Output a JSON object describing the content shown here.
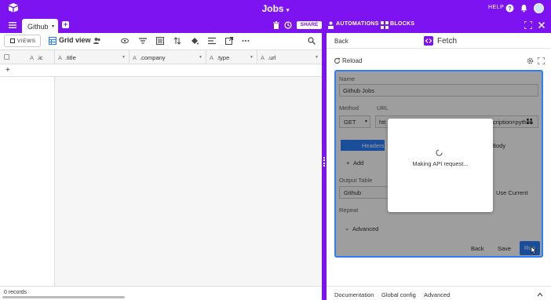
{
  "app": {
    "title": "Jobs",
    "title_caret": "▾",
    "help_label": "HELP",
    "colors": {
      "brand": "#7c13f0",
      "accent": "#2d7ff9"
    }
  },
  "tabbar": {
    "tab_label": "Github",
    "tab_caret": "▾",
    "add_tab": "+",
    "share_label": "SHARE",
    "automations_label": "AUTOMATIONS",
    "blocks_label": "BLOCKS"
  },
  "viewbar": {
    "views_label": "VIEWS",
    "grid_view_label": "Grid view"
  },
  "grid": {
    "columns": [
      {
        "icon": "A",
        "label": ".ic"
      },
      {
        "icon": "A",
        "label": ".title"
      },
      {
        "icon": "A",
        "label": ".company"
      },
      {
        "icon": "A",
        "label": ".type"
      },
      {
        "icon": "A",
        "label": ".url"
      }
    ],
    "add_row": "+",
    "records_label": "0 records"
  },
  "panel": {
    "back_label": "Back",
    "title": "Fetch",
    "reload_label": "Reload",
    "form": {
      "name_label": "Name",
      "name_value": "Github Jobs",
      "method_label": "Method",
      "url_label": "URL",
      "method_value": "GET",
      "url_value_start": "htt",
      "url_value_end": "cription=python",
      "headers_tab": "Headers",
      "body_tab": "Body",
      "add_label": "Add",
      "output_table_label": "Output Table",
      "output_table_value": "Github",
      "use_current_label": "Use Current",
      "repeat_label": "Repeat",
      "advanced_label": "Advanced",
      "back_button": "Back",
      "save_button": "Save",
      "run_button": "Run"
    },
    "modal_text": "Making API request...",
    "footer": {
      "documentation": "Documentation",
      "global_config": "Global config",
      "advanced": "Advanced"
    }
  }
}
